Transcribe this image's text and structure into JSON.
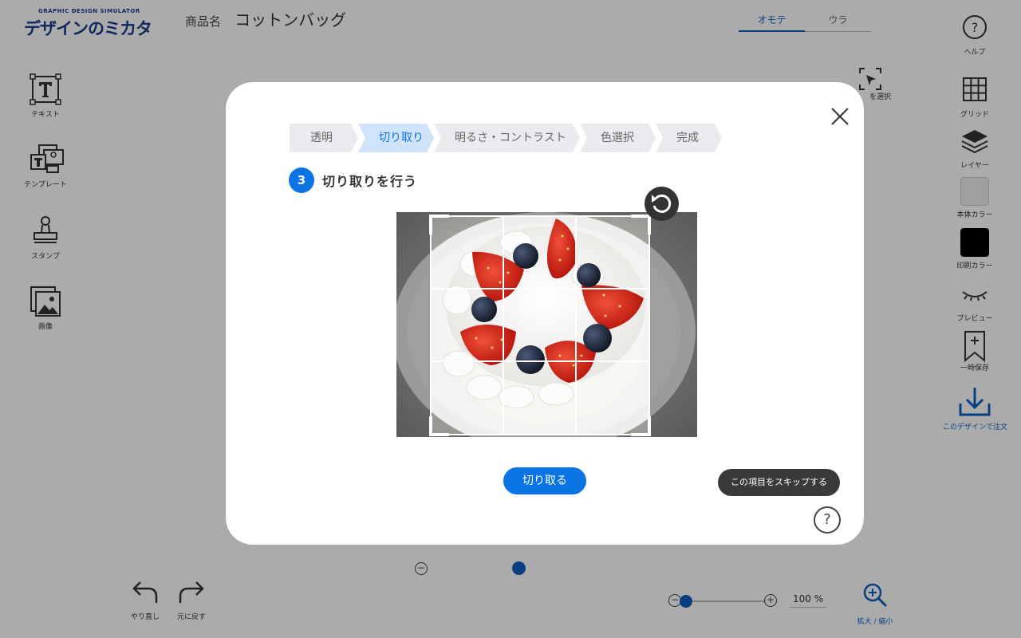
{
  "app": {
    "logo_tagline": "GRAPHIC DESIGN SIMULATOR",
    "logo_title": "デザインのミカタ",
    "product_label": "商品名",
    "product_name": "コットンバッグ",
    "side_tabs": [
      {
        "label": "オモテ",
        "active": true
      },
      {
        "label": "ウラ",
        "active": false
      }
    ],
    "left_tools": [
      {
        "label": "テキスト",
        "icon": "text-icon"
      },
      {
        "label": "テンプレート",
        "icon": "template-icon"
      },
      {
        "label": "スタンプ",
        "icon": "stamp-icon"
      },
      {
        "label": "画像",
        "icon": "image-icon"
      }
    ],
    "select_tool_label": "を選択",
    "right_tools": {
      "help": "ヘルプ",
      "grid": "グリッド",
      "layer": "レイヤー",
      "body_color": "本体カラー",
      "print_color": "印刷カラー",
      "preview": "プレビュー",
      "save": "一時保存",
      "order": "このデザインで注文"
    },
    "colors": {
      "body_color_swatch": "#eeeeee",
      "print_color_swatch": "#000000",
      "accent": "#0b5fc4"
    },
    "undo_label": "やり直し",
    "redo_label": "元に戻す",
    "zoom_percent": "100 %",
    "zoom_tool_label": "拡大 / 縮小",
    "zoom_minus": "−",
    "zoom_plus": "+",
    "rotation_minus": "−"
  },
  "modal": {
    "steps": [
      {
        "label": "透明",
        "active": false
      },
      {
        "label": "切り取り",
        "active": true
      },
      {
        "label": "明るさ・コントラスト",
        "active": false
      },
      {
        "label": "色選択",
        "active": false
      },
      {
        "label": "完成",
        "active": false
      }
    ],
    "step_number": "3",
    "heading": "切り取りを行う",
    "primary_button": "切り取る",
    "skip_button": "この項目をスキップする",
    "help_symbol": "?"
  }
}
